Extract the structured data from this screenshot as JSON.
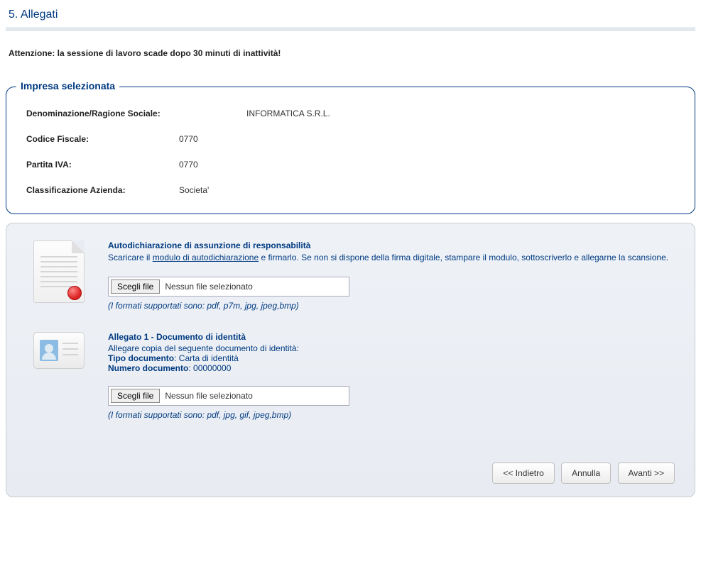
{
  "page": {
    "title": "5. Allegati",
    "warning": "Attenzione: la sessione di lavoro scade dopo 30 minuti di inattività!"
  },
  "companyBox": {
    "legend": "Impresa selezionata",
    "fields": {
      "denominazione_label": "Denominazione/Ragione Sociale:",
      "denominazione_value": "INFORMATICA S.R.L.",
      "codice_fiscale_label": "Codice Fiscale:",
      "codice_fiscale_value": "0770",
      "partita_iva_label": "Partita IVA:",
      "partita_iva_value": "0770",
      "classificazione_label": "Classificazione Azienda:",
      "classificazione_value": "Societa'"
    }
  },
  "attachments": {
    "autodichiarazione": {
      "title": "Autodichiarazione di assunzione di responsabilità",
      "desc_prefix": "Scaricare il ",
      "link_text": "modulo di autodichiarazione",
      "desc_suffix": " e firmarlo. Se non si dispone della firma digitale, stampare il modulo, sottoscriverlo e allegarne la scansione.",
      "choose_file_label": "Scegli file",
      "no_file_text": "Nessun file selezionato",
      "formats_note": "(I formati supportati sono: pdf, p7m, jpg, jpeg,bmp)"
    },
    "documento_identita": {
      "title": "Allegato 1 - Documento di identità",
      "desc": "Allegare copia del seguente documento di identità:",
      "tipo_label": "Tipo documento",
      "tipo_value": "Carta di identità",
      "numero_label": "Numero documento",
      "numero_value": "00000000",
      "choose_file_label": "Scegli file",
      "no_file_text": "Nessun file selezionato",
      "formats_note": "(I formati supportati sono: pdf, jpg, gif, jpeg,bmp)"
    }
  },
  "buttons": {
    "back": "<< Indietro",
    "cancel": "Annulla",
    "next": "Avanti >>"
  }
}
